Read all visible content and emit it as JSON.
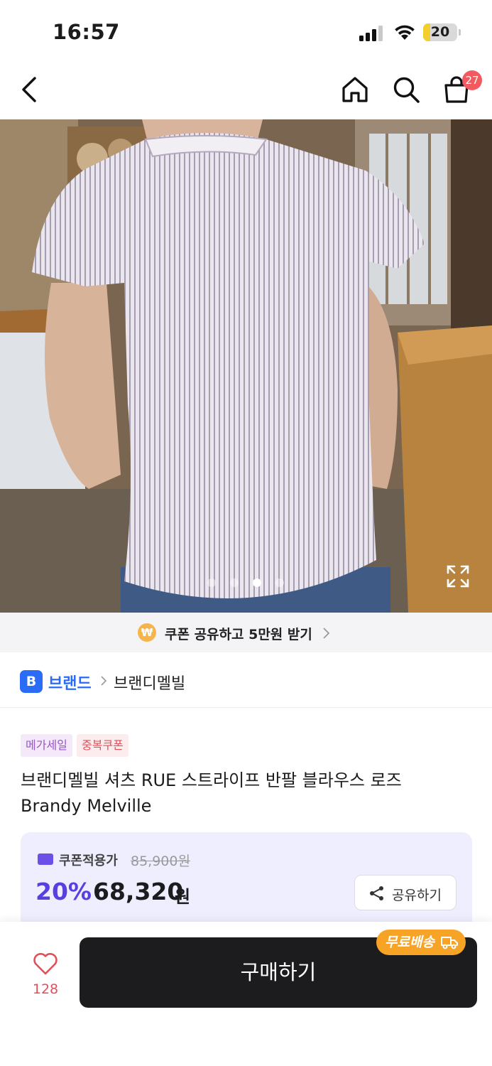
{
  "status_bar": {
    "time": "16:57",
    "battery": "20",
    "battery_level": 0.2
  },
  "nav": {
    "cart_count": "27",
    "icons": [
      "back-icon",
      "home-icon",
      "search-icon",
      "cart-icon"
    ]
  },
  "gallery": {
    "page_count": 4,
    "active_index": 2
  },
  "coupon_banner": {
    "icon": "₩",
    "text": "쿠폰 공유하고 5만원 받기"
  },
  "brand": {
    "badge": "B",
    "label": "브랜드",
    "name": "브랜디멜빌"
  },
  "tags": [
    "메가세일",
    "중복쿠폰"
  ],
  "product": {
    "title_line1": "브랜디멜빌 셔츠 RUE 스트라이프 반팔 블라우스 로즈",
    "title_line2": "Brandy Melville"
  },
  "price": {
    "coupon_label": "쿠폰적용가",
    "original": "85,900원",
    "discount": "20%",
    "amount": "68,320",
    "unit": "원",
    "share_label": "공유하기"
  },
  "bottom_bar": {
    "like_count": "128",
    "buy_label": "구매하기",
    "shipping_badge": "무료배송"
  },
  "colors": {
    "accent": "#5a3fe0",
    "brand_blue": "#2b6cf6",
    "like_red": "#e0505a",
    "badge_orange": "#f7a325"
  }
}
